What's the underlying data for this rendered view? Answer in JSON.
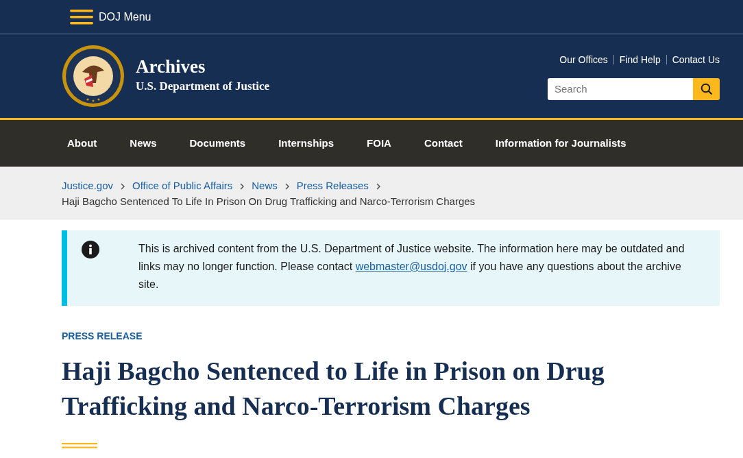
{
  "top_bar": {
    "menu_label": "DOJ Menu"
  },
  "header": {
    "site_title": "Archives",
    "site_subtitle": "U.S. Department of Justice",
    "utility_links": [
      "Our Offices",
      "Find Help",
      "Contact Us"
    ],
    "search": {
      "placeholder": "Search"
    }
  },
  "main_nav": [
    "About",
    "News",
    "Documents",
    "Internships",
    "FOIA",
    "Contact",
    "Information for Journalists"
  ],
  "breadcrumb": [
    {
      "label": "Justice.gov",
      "current": false
    },
    {
      "label": "Office of Public Affairs",
      "current": false
    },
    {
      "label": "News",
      "current": false
    },
    {
      "label": "Press Releases",
      "current": false
    },
    {
      "label": "Haji Bagcho Sentenced To Life In Prison On Drug Trafficking and Narco-Terrorism Charges",
      "current": true
    }
  ],
  "alert": {
    "text_before": "This is archived content from the U.S. Department of Justice website. The information here may be outdated and links may no longer function. Please contact ",
    "link": "webmaster@usdoj.gov",
    "text_after": " if you have any questions about the archive site."
  },
  "article": {
    "label": "PRESS RELEASE",
    "title": "Haji Bagcho Sentenced to Life in Prison on Drug Trafficking and Narco-Terrorism Charges"
  }
}
